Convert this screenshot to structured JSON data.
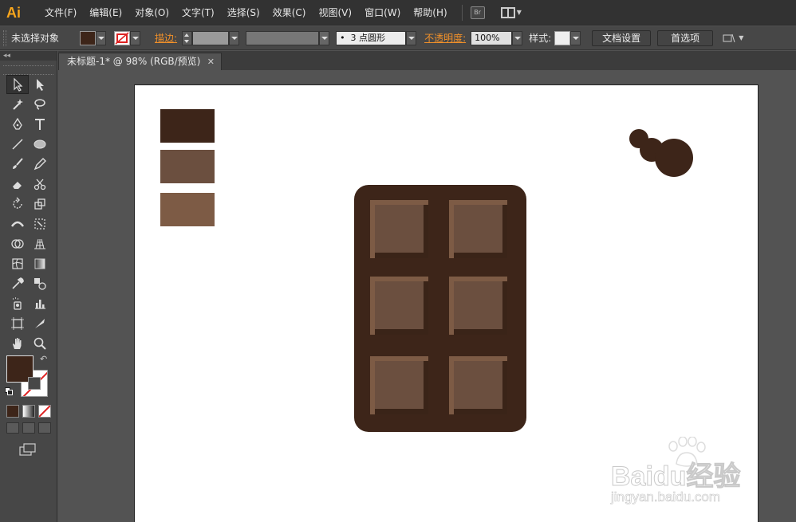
{
  "menubar": {
    "app_logo": "Ai",
    "items": [
      "文件(F)",
      "编辑(E)",
      "对象(O)",
      "文字(T)",
      "选择(S)",
      "效果(C)",
      "视图(V)",
      "窗口(W)",
      "帮助(H)"
    ],
    "bridge_label": "Br"
  },
  "controlbar": {
    "selection_label": "未选择对象",
    "stroke_label": "描边:",
    "brush_value": "3 点圆形",
    "opacity_label": "不透明度:",
    "opacity_value": "100%",
    "style_label": "样式:",
    "doc_setup_button": "文档设置",
    "preferences_button": "首选项",
    "fill_color": "#3d2519"
  },
  "tools_panel": {
    "collapse": "◂◂"
  },
  "document": {
    "tab_title": "未标题-1* @ 98% (RGB/预览)",
    "close": "✕"
  },
  "artwork": {
    "swatches": [
      "#3d2519",
      "#6b4f3f",
      "#7d5b45"
    ],
    "chocolate_bar_color": "#3d2519",
    "chocolate_piece_color": "#6b4f3f",
    "chocolate_highlight_color": "#7d5b45",
    "bubble_color": "#3d2519"
  },
  "watermark": {
    "brand": "Baidu经验",
    "url": "jingyan.baidu.com"
  }
}
